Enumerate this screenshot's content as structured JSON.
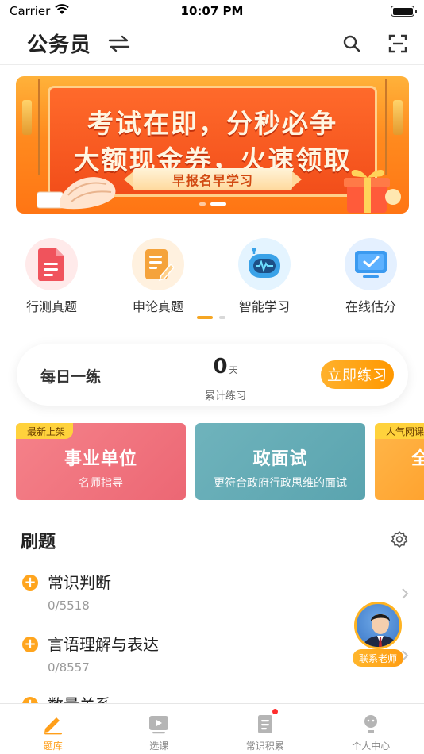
{
  "status_bar": {
    "carrier": "Carrier",
    "time": "10:07 PM",
    "battery_level": 1.0
  },
  "nav": {
    "title": "公务员"
  },
  "banner": {
    "line1": "考试在即，分秒必争",
    "line2": "大额现金券，火速领取",
    "ribbon": "早报名早学习",
    "page_count": 2,
    "active_page": 2
  },
  "shortcuts": [
    {
      "label": "行测真题",
      "icon": "document-icon",
      "color": "#f0535c"
    },
    {
      "label": "申论真题",
      "icon": "edit-note-icon",
      "color": "#f5a33b"
    },
    {
      "label": "智能学习",
      "icon": "robot-icon",
      "color": "#3aa2e8"
    },
    {
      "label": "在线估分",
      "icon": "monitor-check-icon",
      "color": "#3b9af0"
    }
  ],
  "daily": {
    "title": "每日一练",
    "count": "0",
    "unit": "天",
    "sub": "累计练习",
    "button": "立即练习"
  },
  "cards": [
    {
      "tag": "最新上架",
      "title": "事业单位",
      "sub": "名师指导"
    },
    {
      "tag": "",
      "title": "政面试",
      "sub": "更符合政府行政思维的面试"
    },
    {
      "tag": "人气网课",
      "title": "全",
      "sub": ""
    }
  ],
  "practice": {
    "title": "刷题",
    "topics": [
      {
        "name": "常识判断",
        "count": "0/5518"
      },
      {
        "name": "言语理解与表达",
        "count": "0/8557"
      },
      {
        "name": "数量关系",
        "count": ""
      }
    ]
  },
  "teacher": {
    "label": "联系老师"
  },
  "tabs": [
    {
      "label": "题库",
      "icon": "pencil-icon",
      "active": true
    },
    {
      "label": "选课",
      "icon": "video-play-icon",
      "active": false
    },
    {
      "label": "常识积累",
      "icon": "notebook-icon",
      "active": false,
      "badge": true
    },
    {
      "label": "个人中心",
      "icon": "person-icon",
      "active": false
    }
  ],
  "colors": {
    "accent": "#ff9f1a",
    "tab_inactive": "#888888",
    "badge": "#ff2d2d"
  }
}
